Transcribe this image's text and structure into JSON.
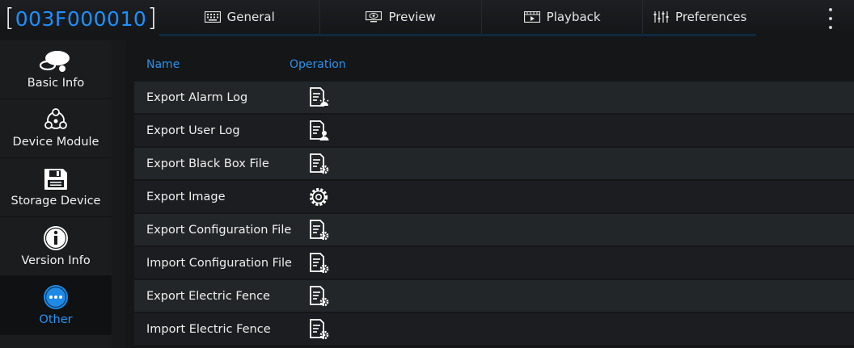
{
  "header": {
    "device_id": "003F000010",
    "bracket_left": "[",
    "bracket_right": "]",
    "tabs": [
      {
        "label": "General",
        "icon": "keyboard-icon",
        "active": true
      },
      {
        "label": "Preview",
        "icon": "preview-eye-icon",
        "active": false
      },
      {
        "label": "Playback",
        "icon": "playback-icon",
        "active": false
      },
      {
        "label": "Preferences",
        "icon": "sliders-icon",
        "active": false
      }
    ]
  },
  "sidebar": {
    "items": [
      {
        "label": "Basic Info",
        "icon": "basic-info-icon",
        "active": false
      },
      {
        "label": "Device Module",
        "icon": "device-module-icon",
        "active": false
      },
      {
        "label": "Storage Device",
        "icon": "storage-device-icon",
        "active": false
      },
      {
        "label": "Version Info",
        "icon": "info-icon",
        "active": false
      },
      {
        "label": "Other",
        "icon": "more-dots-icon",
        "active": true
      }
    ]
  },
  "table": {
    "columns": {
      "name": "Name",
      "operation": "Operation"
    },
    "rows": [
      {
        "name": "Export Alarm Log",
        "icon": "alarm-log-icon"
      },
      {
        "name": "Export User Log",
        "icon": "user-log-icon"
      },
      {
        "name": "Export Black Box File",
        "icon": "file-settings-icon"
      },
      {
        "name": "Export Image",
        "icon": "gear-icon"
      },
      {
        "name": "Export Configuration File",
        "icon": "file-settings-icon"
      },
      {
        "name": "Import Configuration File",
        "icon": "file-settings-icon"
      },
      {
        "name": "Export Electric Fence",
        "icon": "file-settings-icon"
      },
      {
        "name": "Import Electric Fence",
        "icon": "file-settings-icon"
      }
    ]
  },
  "colors": {
    "accent": "#1e90ff",
    "background": "#141618",
    "row_alt": "#232628"
  }
}
